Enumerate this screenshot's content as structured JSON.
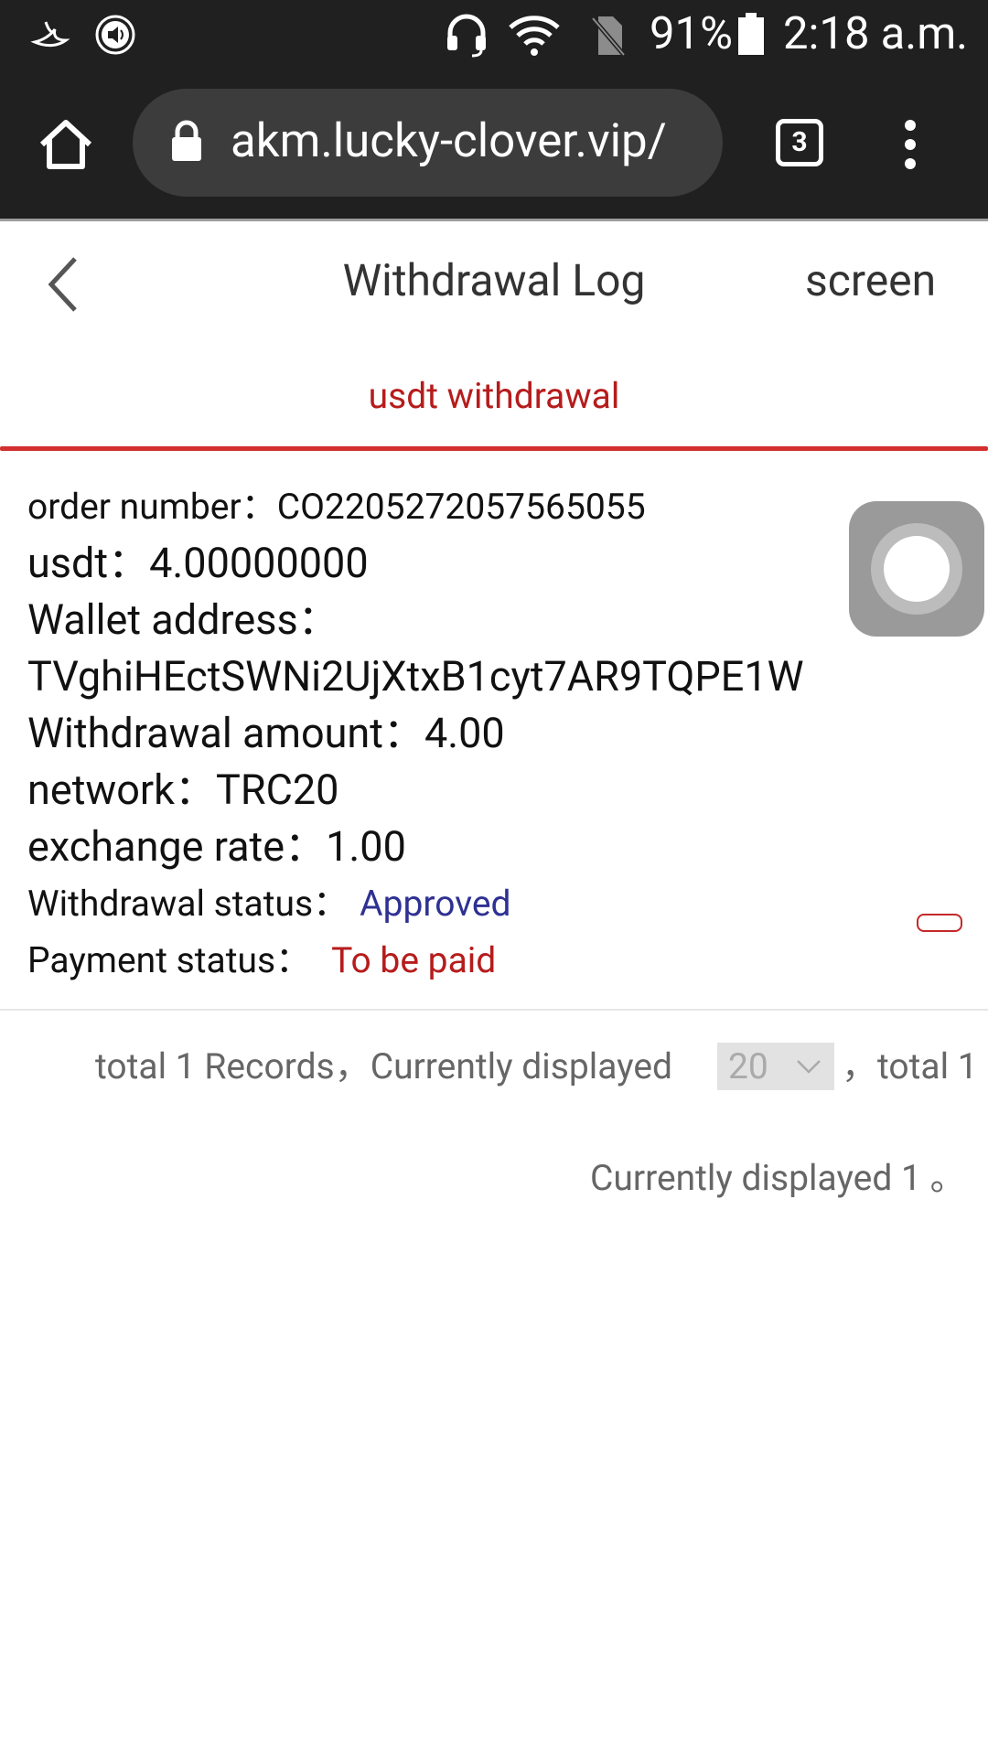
{
  "status_bar": {
    "battery": "91%",
    "time": "2:18 a.m.",
    "icons": [
      "bird-notification-icon",
      "speaker-notification-icon",
      "headset-icon",
      "wifi-icon",
      "no-sim-icon",
      "battery-icon"
    ]
  },
  "browser": {
    "url": "akm.lucky-clover.vip/",
    "tab_count": "3"
  },
  "header": {
    "title": "Withdrawal Log",
    "right_action": "screen"
  },
  "tabs": [
    {
      "label": "usdt withdrawal",
      "active": true
    }
  ],
  "record": {
    "order_number": {
      "label": "order number：",
      "value": "CO2205272057565055"
    },
    "usdt": {
      "label": "usdt：",
      "value": "4.00000000"
    },
    "wallet_address": {
      "label": "Wallet address：",
      "value": "TVghiHEctSWNi2UjXtxB1cyt7AR9TQPE1W"
    },
    "withdrawal_amount": {
      "label": "Withdrawal amount：",
      "value": "4.00"
    },
    "network": {
      "label": "network：",
      "value": "TRC20"
    },
    "exchange_rate": {
      "label": "exchange rate：",
      "value": "1.00"
    },
    "withdrawal_status": {
      "label": "Withdrawal status：",
      "value": "Approved"
    },
    "payment_status": {
      "label": "Payment status：",
      "value": "To be paid"
    }
  },
  "pagination": {
    "text_before": "total 1 Records，Currently displayed",
    "page_size": "20",
    "text_after": "，total 1",
    "line2": "Currently displayed 1 。"
  },
  "colors": {
    "accent_red": "#d32f2f",
    "approved_blue": "#2e3192",
    "browser_bar": "#202020"
  }
}
